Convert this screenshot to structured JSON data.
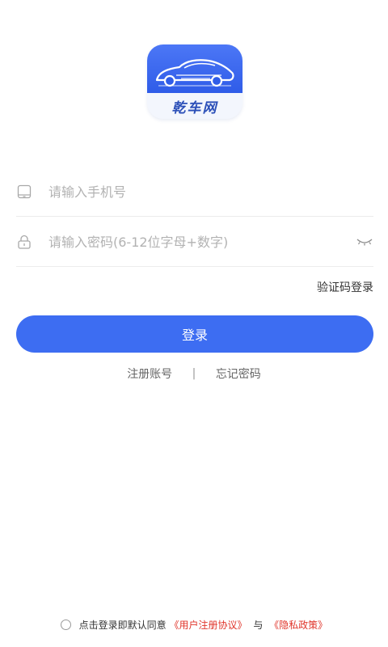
{
  "brand": {
    "logo_text": "乾车网",
    "colors": {
      "accent": "#3d6df2",
      "logo_blue": "#2f5ce8",
      "link_red": "#e0352b"
    }
  },
  "form": {
    "phone_placeholder": "请输入手机号",
    "phone_value": "",
    "password_placeholder": "请输入密码(6-12位字母+数字)",
    "password_value": "",
    "phone_icon": "phone-icon",
    "lock_icon": "lock-icon",
    "eye_icon": "eye-closed-icon"
  },
  "sms_login_label": "验证码登录",
  "login_button_label": "登录",
  "links": {
    "register": "注册账号",
    "separator": "|",
    "forgot": "忘记密码"
  },
  "agreement": {
    "prefix": "点击登录即默认同意",
    "user_agreement": "《用户注册协议》",
    "conjunction": "与",
    "privacy_policy": "《隐私政策》",
    "checked": false
  }
}
